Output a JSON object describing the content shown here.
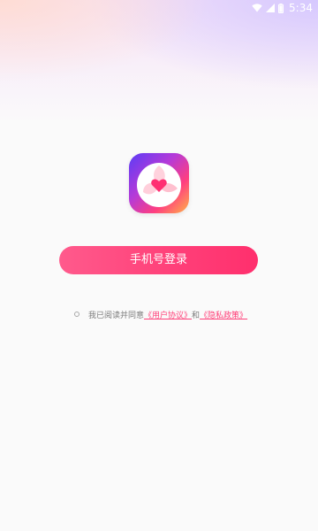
{
  "status_bar": {
    "time": "5:34",
    "icons": [
      "wifi-icon",
      "signal-icon",
      "battery-icon"
    ]
  },
  "logo": {
    "icon": "app-logo-heart-icon"
  },
  "login": {
    "button_label": "手机号登录"
  },
  "agreement": {
    "prefix": "我已阅读并同意",
    "user_agreement": "《用户协议》",
    "connector": "和",
    "privacy_policy": "《隐私政策》"
  },
  "colors": {
    "accent": "#ff3f78",
    "button_gradient_start": "#ff5a8c",
    "button_gradient_end": "#ff2f6d",
    "background": "#fafafa"
  }
}
